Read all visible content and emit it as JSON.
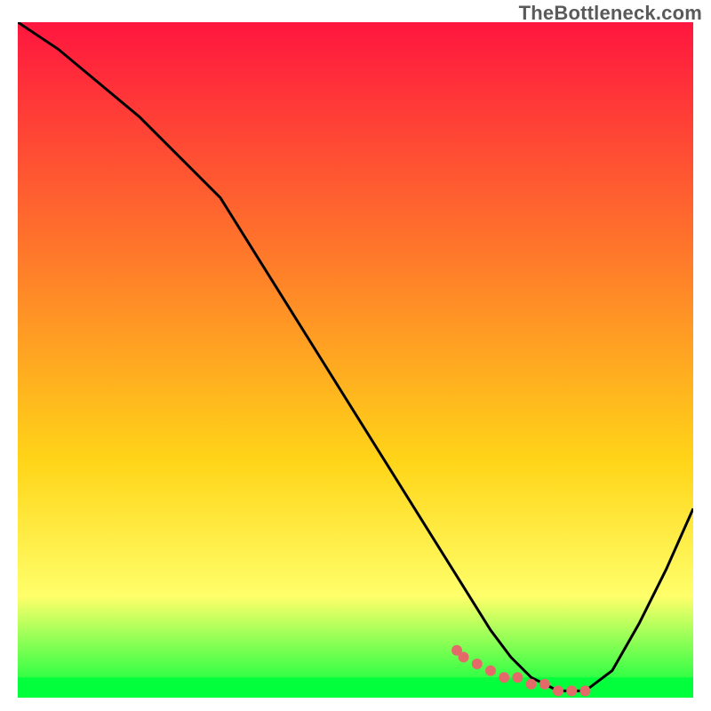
{
  "watermark": "TheBottleneck.com",
  "colors": {
    "gradient_top": "#ff163f",
    "gradient_mid1": "#ff7a2a",
    "gradient_mid2": "#ffd518",
    "gradient_mid3": "#ffff6a",
    "gradient_bottom": "#00ff3c",
    "curve": "#000000",
    "marker": "#e46a6a"
  },
  "chart_data": {
    "type": "line",
    "title": "",
    "xlabel": "",
    "ylabel": "",
    "xlim": [
      0,
      100
    ],
    "ylim": [
      0,
      100
    ],
    "x": [
      0,
      6,
      12,
      18,
      25,
      30,
      35,
      40,
      45,
      50,
      55,
      60,
      65,
      70,
      73,
      76,
      80,
      84,
      88,
      92,
      96,
      100
    ],
    "values": [
      100,
      96,
      91,
      86,
      79,
      74,
      66,
      58,
      50,
      42,
      34,
      26,
      18,
      10,
      6,
      3,
      1,
      1,
      4,
      11,
      19,
      28
    ],
    "markers": {
      "x": [
        65,
        66,
        68,
        70,
        72,
        74,
        76,
        78,
        80,
        82,
        84
      ],
      "y": [
        7,
        6,
        5,
        4,
        3,
        3,
        2,
        2,
        1,
        1,
        1
      ]
    },
    "green_band": {
      "y_from": 0,
      "y_to": 3
    },
    "grid": false,
    "legend": null
  }
}
